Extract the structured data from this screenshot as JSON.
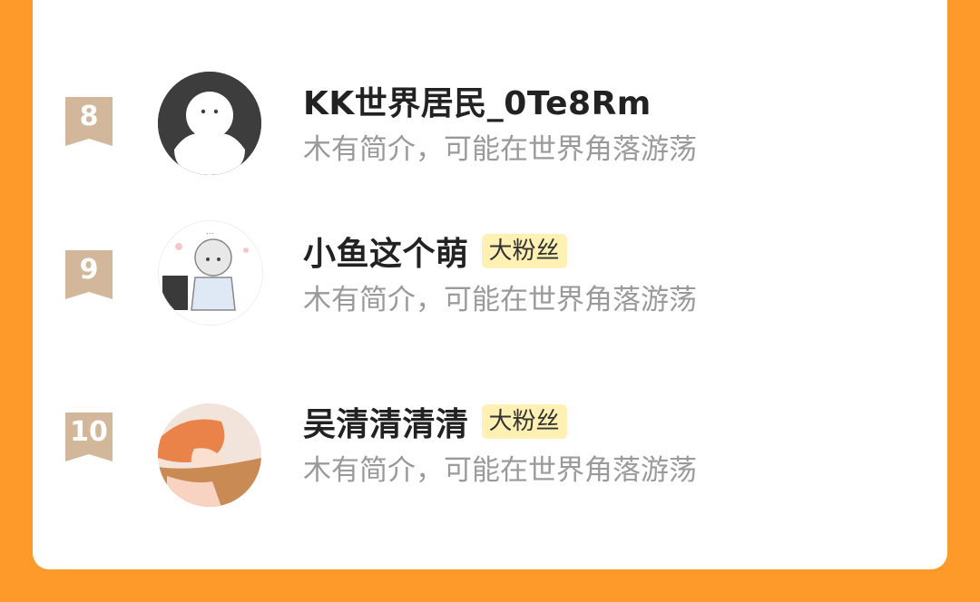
{
  "colors": {
    "background": "#FD9A2A",
    "card": "#ffffff",
    "badge_bg": "#FFF1B3",
    "rank_ribbon": "#D2B79B"
  },
  "fans": [
    {
      "rank": "8",
      "name": "KK世界居民_0Te8Rm",
      "badge": "",
      "bio": "木有简介，可能在世界角落游荡",
      "avatar": "default-ghost-avatar"
    },
    {
      "rank": "9",
      "name": "小鱼这个萌",
      "badge": "大粉丝",
      "bio": "木有简介，可能在世界角落游荡",
      "avatar": "anime-chibi-avatar"
    },
    {
      "rank": "10",
      "name": "吴清清清清",
      "badge": "大粉丝",
      "bio": "木有简介，可能在世界角落游荡",
      "avatar": "anime-boy-avatar"
    }
  ]
}
